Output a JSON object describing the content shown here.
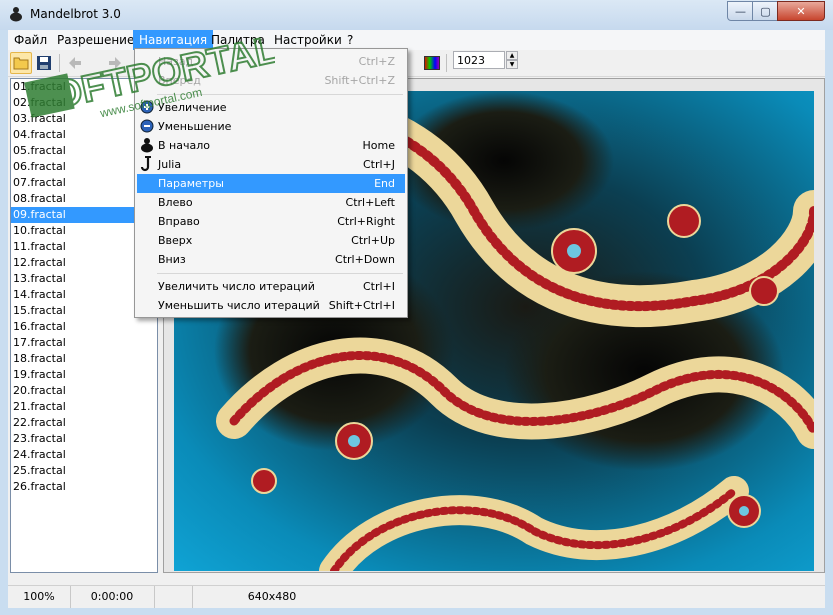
{
  "window": {
    "title": "Mandelbrot 3.0",
    "close_label": "✕",
    "max_label": "▢",
    "min_label": "—"
  },
  "menu": [
    "Файл",
    "Разрешение",
    "Навигация",
    "Палитра",
    "Настройки",
    "?"
  ],
  "toolbar": {
    "iterations": "1023"
  },
  "dropdown": {
    "undo": {
      "label": "Назад",
      "shortcut": "Ctrl+Z"
    },
    "redo": {
      "label": "Вперед",
      "shortcut": "Shift+Ctrl+Z"
    },
    "zoom_in": {
      "label": "Увеличение"
    },
    "zoom_out": {
      "label": "Уменьшение"
    },
    "home": {
      "label": "В начало",
      "shortcut": "Home"
    },
    "julia": {
      "label": "Julia",
      "shortcut": "Ctrl+J"
    },
    "params": {
      "label": "Параметры",
      "shortcut": "End"
    },
    "left": {
      "label": "Влево",
      "shortcut": "Ctrl+Left"
    },
    "right": {
      "label": "Вправо",
      "shortcut": "Ctrl+Right"
    },
    "up": {
      "label": "Вверх",
      "shortcut": "Ctrl+Up"
    },
    "down": {
      "label": "Вниз",
      "shortcut": "Ctrl+Down"
    },
    "inc_iter": {
      "label": "Увеличить число итераций",
      "shortcut": "Ctrl+I"
    },
    "dec_iter": {
      "label": "Уменьшить число итераций",
      "shortcut": "Shift+Ctrl+I"
    }
  },
  "files": [
    "01.fractal",
    "02.fractal",
    "03.fractal",
    "04.fractal",
    "05.fractal",
    "06.fractal",
    "07.fractal",
    "08.fractal",
    "09.fractal",
    "10.fractal",
    "11.fractal",
    "12.fractal",
    "13.fractal",
    "14.fractal",
    "15.fractal",
    "16.fractal",
    "17.fractal",
    "18.fractal",
    "19.fractal",
    "20.fractal",
    "21.fractal",
    "22.fractal",
    "23.fractal",
    "24.fractal",
    "25.fractal",
    "26.fractal"
  ],
  "status": {
    "zoom": "100%",
    "time": "0:00:00",
    "resolution": "640x480"
  },
  "watermark": {
    "text": "SOFTPORTAL",
    "url": "www.softportal.com"
  },
  "colors": {
    "accent": "#3399ff",
    "fractal_sea": "#0a9ccc",
    "fractal_gold": "#ecd79a",
    "fractal_red": "#b01c22"
  }
}
